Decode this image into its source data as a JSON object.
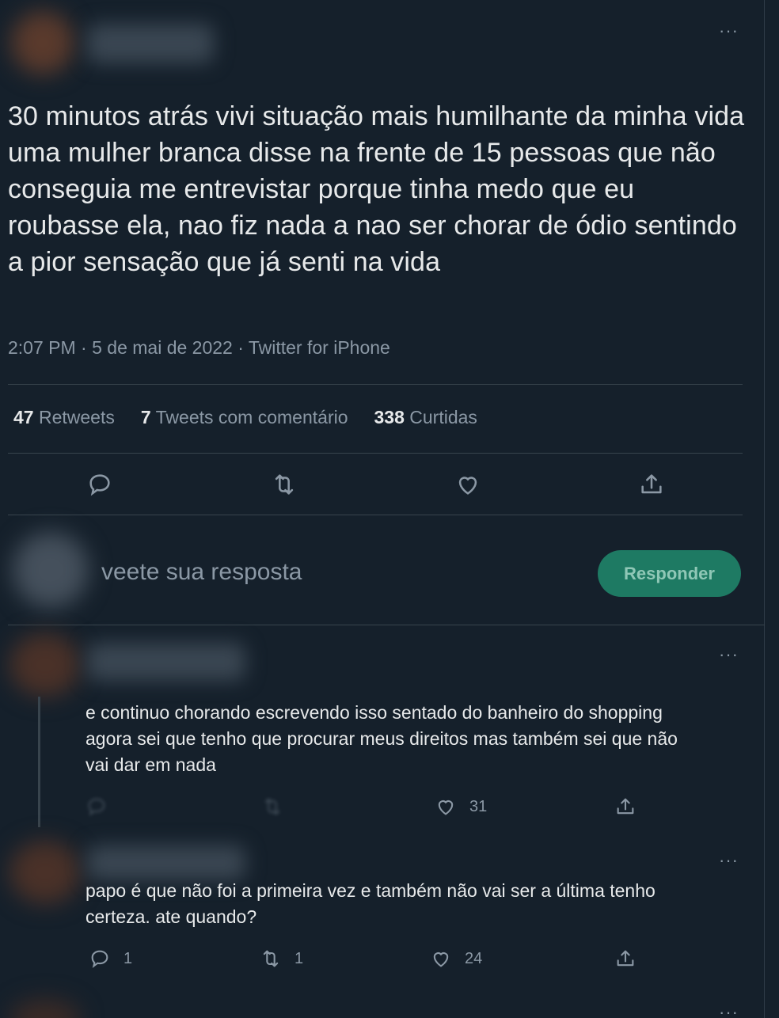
{
  "tweet": {
    "more_label": "···",
    "text": "30 minutos atrás vivi situação mais humilhante da minha vida uma mulher branca disse na frente de 15 pessoas que não conseguia me entrevistar porque tinha medo que eu roubasse ela, nao fiz nada a nao ser chorar de ódio sentindo a pior sensação que já senti na vida",
    "meta": "2:07 PM · 5 de mai de 2022 · Twitter for iPhone",
    "stats": {
      "retweets_count": "47",
      "retweets_label": "Retweets",
      "quotes_count": "7",
      "quotes_label": "Tweets com comentário",
      "likes_count": "338",
      "likes_label": "Curtidas"
    },
    "actions": [
      "reply-icon",
      "retweet-icon",
      "like-icon",
      "share-icon"
    ]
  },
  "composer": {
    "placeholder": "veete sua resposta",
    "button_label": "Responder"
  },
  "replies": [
    {
      "more_label": "···",
      "text_line1": "e continuo chorando escrevendo isso sentado do banheiro do shopping",
      "text_line2": "agora sei que tenho que procurar meus direitos mas também sei que não",
      "text_line3": "vai dar em nada",
      "likes": "31"
    },
    {
      "more_label": "···",
      "text_line1": "papo é que não foi a primeira vez e também não vai ser a última tenho",
      "text_line2": "certeza. ate quando?",
      "replies": "1",
      "retweets": "1",
      "likes": "24"
    }
  ],
  "colors": {
    "background": "#15202b",
    "text": "#e7e9ea",
    "muted": "#8b98a5",
    "divider": "#38444d",
    "button": "#1e7a63"
  }
}
